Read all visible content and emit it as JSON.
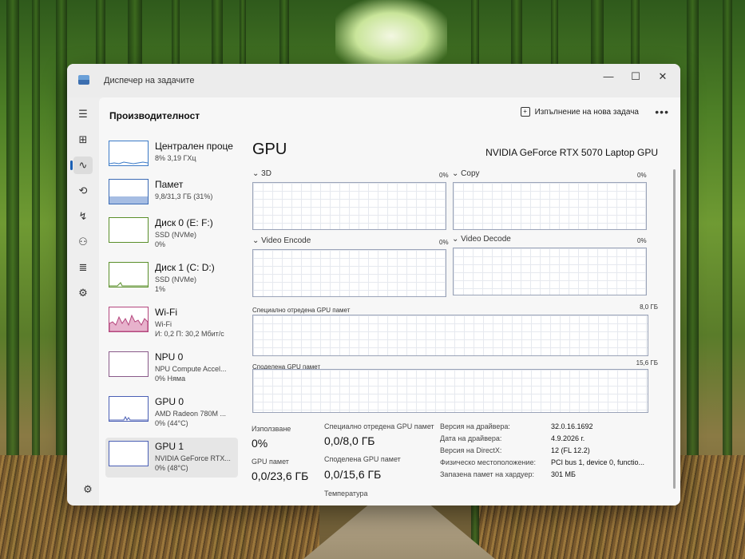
{
  "window": {
    "title": "Диспечер на задачите",
    "controls": {
      "minimize": "—",
      "maximize": "☐",
      "close": "✕"
    }
  },
  "nav": [
    "hamburger-icon",
    "processes-icon",
    "performance-icon",
    "history-icon",
    "startup-icon",
    "users-icon",
    "details-icon",
    "services-icon",
    "settings-icon"
  ],
  "header": {
    "title": "Производителност",
    "run_new_task": "Изпълнение на нова задача",
    "more": "•••"
  },
  "devices": [
    {
      "name": "Централен проце",
      "line2": "8% 3,19 ГХц",
      "line3": ""
    },
    {
      "name": "Памет",
      "line2": "9,8/31,3 ГБ (31%)",
      "line3": ""
    },
    {
      "name": "Диск 0 (E: F:)",
      "line2": "SSD (NVMe)",
      "line3": "0%"
    },
    {
      "name": "Диск 1 (C: D:)",
      "line2": "SSD (NVMe)",
      "line3": "1%"
    },
    {
      "name": "Wi-Fi",
      "line2": "Wi-Fi",
      "line3": "И: 0,2 П: 30,2 Мбит/с"
    },
    {
      "name": "NPU 0",
      "line2": "NPU Compute Accel...",
      "line3": "0% Няма"
    },
    {
      "name": "GPU 0",
      "line2": "AMD Radeon 780M ...",
      "line3": "0% (44°C)"
    },
    {
      "name": "GPU 1",
      "line2": "NVIDIA GeForce RTX...",
      "line3": "0% (48°C)"
    }
  ],
  "main": {
    "title": "GPU",
    "model": "NVIDIA GeForce RTX 5070 Laptop GPU",
    "engines": [
      {
        "label": "3D",
        "pct": "0%"
      },
      {
        "label": "Copy",
        "pct": "0%"
      },
      {
        "label": "Video Encode",
        "pct": "0%"
      },
      {
        "label": "Video Decode",
        "pct": "0%"
      }
    ],
    "dedicated_graph": {
      "label": "Специално отредена GPU памет",
      "max": "8,0 ГБ"
    },
    "shared_graph": {
      "label": "Споделена GPU памет",
      "max": "15,6 ГБ"
    },
    "stats": {
      "usage_label": "Използване",
      "usage_value": "0%",
      "dedicated_label": "Специално отредена GPU памет",
      "dedicated_value": "0,0/8,0 ГБ",
      "gpu_mem_label": "GPU памет",
      "gpu_mem_value": "0,0/23,6 ГБ",
      "shared_label": "Споделена GPU памет",
      "shared_value": "0,0/15,6 ГБ",
      "temp_label": "Температура"
    },
    "properties": [
      {
        "label": "Версия на драйвера:",
        "value": "32.0.16.1692"
      },
      {
        "label": "Дата на драйвера:",
        "value": "4.9.2026 г."
      },
      {
        "label": "Версия на DirectX:",
        "value": "12 (FL 12.2)"
      },
      {
        "label": "Физическо местоположение:",
        "value": "PCI bus 1, device 0, functio..."
      },
      {
        "label": "Запазена памет на хардуер:",
        "value": "301 МБ"
      }
    ]
  }
}
